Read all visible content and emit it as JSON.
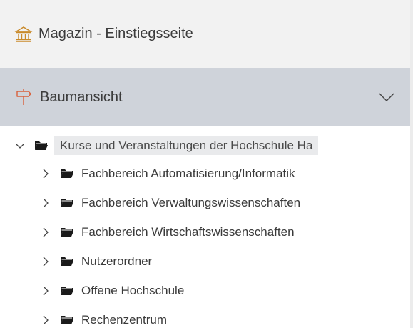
{
  "magazin": {
    "label": "Magazin - Einstiegsseite",
    "icon": "repository-icon"
  },
  "tree_header": {
    "label": "Baumansicht",
    "icon": "signpost-icon",
    "toggle_icon": "chevron-down-icon"
  },
  "tree": {
    "root": {
      "label": "Kurse und Veranstaltungen der Hochschule Ha",
      "expanded": true
    },
    "children": [
      {
        "label": "Fachbereich Automatisierung/Informatik"
      },
      {
        "label": "Fachbereich Verwaltungswissenschaften"
      },
      {
        "label": "Fachbereich Wirtschaftswissenschaften"
      },
      {
        "label": "Nutzerordner"
      },
      {
        "label": "Offene Hochschule"
      },
      {
        "label": "Rechenzentrum"
      }
    ]
  },
  "colors": {
    "header_bg": "#f2f2f2",
    "tree_header_bg": "#cfd3da",
    "root_highlight": "#e9eaec",
    "icon_color": "#1a1a1a"
  }
}
